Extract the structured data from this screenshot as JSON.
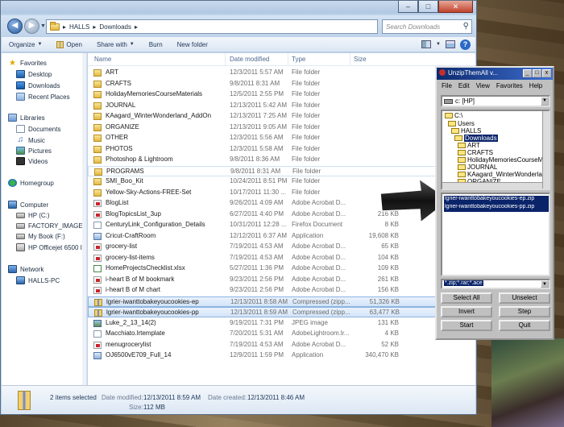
{
  "explorer": {
    "breadcrumb": [
      "HALLS",
      "Downloads"
    ],
    "search_placeholder": "Search Downloads",
    "toolbar": {
      "organize": "Organize",
      "open": "Open",
      "share_with": "Share with",
      "burn": "Burn",
      "new_folder": "New folder"
    },
    "nav": {
      "favorites": "Favorites",
      "desktop": "Desktop",
      "downloads": "Downloads",
      "recent": "Recent Places",
      "libraries": "Libraries",
      "documents": "Documents",
      "music": "Music",
      "pictures": "Pictures",
      "videos": "Videos",
      "homegroup": "Homegroup",
      "computer": "Computer",
      "drive_c": "HP (C:)",
      "drive_factory": "FACTORY_IMAGE",
      "drive_f": "My Book (F:)",
      "printer": "HP Officejet 6500 I",
      "network": "Network",
      "halls_pc": "HALLS-PC"
    },
    "columns": {
      "name": "Name",
      "date": "Date modified",
      "type": "Type",
      "size": "Size"
    },
    "files": [
      {
        "name": "ART",
        "date": "12/3/2011 5:57 AM",
        "type": "File folder",
        "size": "",
        "icon": "folder"
      },
      {
        "name": "CRAFTS",
        "date": "9/8/2011 8:31 AM",
        "type": "File folder",
        "size": "",
        "icon": "folder"
      },
      {
        "name": "HolidayMemoriesCourseMaterials",
        "date": "12/5/2011 2:55 PM",
        "type": "File folder",
        "size": "",
        "icon": "folder"
      },
      {
        "name": "JOURNAL",
        "date": "12/13/2011 5:42 AM",
        "type": "File folder",
        "size": "",
        "icon": "folder"
      },
      {
        "name": "KAagard_WinterWonderland_AddOn",
        "date": "12/13/2011 7:25 AM",
        "type": "File folder",
        "size": "",
        "icon": "folder"
      },
      {
        "name": "ORGANIZE",
        "date": "12/13/2011 9:05 AM",
        "type": "File folder",
        "size": "",
        "icon": "folder"
      },
      {
        "name": "OTHER",
        "date": "12/3/2011 5:56 AM",
        "type": "File folder",
        "size": "",
        "icon": "folder"
      },
      {
        "name": "PHOTOS",
        "date": "12/3/2011 5:58 AM",
        "type": "File folder",
        "size": "",
        "icon": "folder"
      },
      {
        "name": "Photoshop & Lightroom",
        "date": "9/8/2011 8:36 AM",
        "type": "File folder",
        "size": "",
        "icon": "folder"
      },
      {
        "name": "PROGRAMS",
        "date": "9/8/2011 8:31 AM",
        "type": "File folder",
        "size": "",
        "icon": "folder"
      },
      {
        "name": "SMI_Boo_Kit",
        "date": "10/24/2011 8:51 PM",
        "type": "File folder",
        "size": "",
        "icon": "folder"
      },
      {
        "name": "Yellow-Sky-Actions-FREE-Set",
        "date": "10/17/2011 11:30 ...",
        "type": "File folder",
        "size": "",
        "icon": "folder"
      },
      {
        "name": "BlogList",
        "date": "9/26/2011 4:09 AM",
        "type": "Adobe Acrobat D...",
        "size": "37",
        "icon": "pdf"
      },
      {
        "name": "BlogTopicsList_3up",
        "date": "6/27/2011 4:40 PM",
        "type": "Adobe Acrobat D...",
        "size": "216 KB",
        "icon": "pdf"
      },
      {
        "name": "CenturyLink_Configuration_Details",
        "date": "10/31/2011 12:28 ...",
        "type": "Firefox Document",
        "size": "8 KB",
        "icon": "doc"
      },
      {
        "name": "Cricut-CraftRoom",
        "date": "12/12/2011 6:37 AM",
        "type": "Application",
        "size": "19,608 KB",
        "icon": "exe"
      },
      {
        "name": "grocery-list",
        "date": "7/19/2011 4:53 AM",
        "type": "Adobe Acrobat D...",
        "size": "65 KB",
        "icon": "pdf"
      },
      {
        "name": "grocery-list-items",
        "date": "7/19/2011 4:53 AM",
        "type": "Adobe Acrobat D...",
        "size": "104 KB",
        "icon": "pdf"
      },
      {
        "name": "HomeProjectsChecklist.xlsx",
        "date": "5/27/2011 1:36 PM",
        "type": "Adobe Acrobat D...",
        "size": "109 KB",
        "icon": "xlsx"
      },
      {
        "name": "i-heart B of M bookmark",
        "date": "9/23/2011 2:56 PM",
        "type": "Adobe Acrobat D...",
        "size": "261 KB",
        "icon": "pdf"
      },
      {
        "name": "i-heart B of M chart",
        "date": "9/23/2011 2:56 PM",
        "type": "Adobe Acrobat D...",
        "size": "156 KB",
        "icon": "pdf"
      },
      {
        "name": "lgrier-iwanttobakeyoucookies-ep",
        "date": "12/13/2011 8:58 AM",
        "type": "Compressed (zipp...",
        "size": "51,326 KB",
        "icon": "zip",
        "selected": true
      },
      {
        "name": "lgrier-iwanttobakeyoucookies-pp",
        "date": "12/13/2011 8:59 AM",
        "type": "Compressed (zipp...",
        "size": "63,477 KB",
        "icon": "zip",
        "selected": true
      },
      {
        "name": "Luke_2_13_14(2)",
        "date": "9/19/2011 7:31 PM",
        "type": "JPEG image",
        "size": "131 KB",
        "icon": "img"
      },
      {
        "name": "Macchiato.lrtemplate",
        "date": "7/20/2011 5:31 AM",
        "type": "AdobeLightroom.lr...",
        "size": "4 KB",
        "icon": "doc"
      },
      {
        "name": "menugrocerylist",
        "date": "7/19/2011 4:53 AM",
        "type": "Adobe Acrobat D...",
        "size": "52 KB",
        "icon": "pdf"
      },
      {
        "name": "OJ6500vE709_Full_14",
        "date": "12/9/2011 1:59 PM",
        "type": "Application",
        "size": "340,470 KB",
        "icon": "exe"
      }
    ],
    "status": {
      "count": "2 items selected",
      "modified_label": "Date modified:",
      "modified_value": "12/13/2011 8:59 AM",
      "created_label": "Date created:",
      "created_value": "12/13/2011 8:46 AM",
      "size_label": "Size:",
      "size_value": "112 MB"
    }
  },
  "unzip": {
    "title": "UnzipThemAll v...",
    "menu": [
      "File",
      "Edit",
      "View",
      "Favorites",
      "Help"
    ],
    "drive": "c: [HP]",
    "tree": [
      "C:\\",
      "Users",
      "HALLS",
      "Downloads",
      "ART",
      "CRAFTS",
      "HolidayMemoriesCourseMaterials",
      "JOURNAL",
      "KAagard_WinterWonderland_AddO",
      "ORGANIZE"
    ],
    "files": [
      "lgrier-iwanttobakeyoucookies-ep.zip",
      "lgrier-iwanttobakeyoucookies-pp.zip"
    ],
    "filter": "*.zip;*.rar;*.ace",
    "buttons": {
      "select_all": "Select All",
      "unselect": "Unselect",
      "invert": "Invert",
      "step": "Step",
      "start": "Start",
      "quit": "Quit"
    }
  }
}
